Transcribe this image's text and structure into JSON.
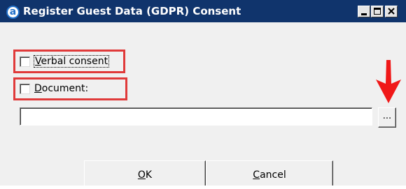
{
  "window": {
    "title": "Register Guest Data (GDPR) Consent",
    "app_icon_letter": "a",
    "title_bar_color": "#10346c",
    "controls": {
      "minimize_icon": "minimize-icon",
      "maximize_icon": "maximize-icon",
      "close_icon": "close-icon"
    }
  },
  "consent": {
    "verbal": {
      "label": "Verbal consent",
      "access_key": "V",
      "checked": false
    },
    "document": {
      "label": "Document:",
      "access_key": "D",
      "checked": false
    },
    "highlight_color": "#e03a3a"
  },
  "document_path": {
    "value": "",
    "placeholder": ""
  },
  "browse_button": {
    "label": "..."
  },
  "annotation": {
    "arrow_color": "#f01818",
    "arrow_icon": "arrow-down-icon"
  },
  "buttons": {
    "ok": {
      "label": "OK",
      "access_key": "O"
    },
    "cancel": {
      "label": "Cancel",
      "access_key": "C"
    }
  }
}
